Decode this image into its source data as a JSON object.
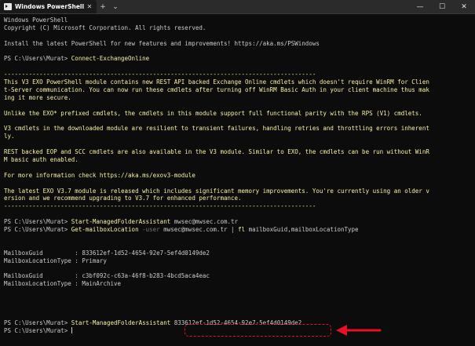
{
  "window": {
    "tab_title": "Windows PowerShell",
    "tab_close": "✕",
    "new_tab": "+",
    "dropdown": "⌄",
    "minimize": "—",
    "maximize": "☐",
    "close": "✕"
  },
  "terminal": {
    "lines": [
      {
        "parts": [
          {
            "t": "Windows PowerShell",
            "c": ""
          }
        ]
      },
      {
        "parts": [
          {
            "t": "Copyright (C) Microsoft Corporation. All rights reserved.",
            "c": ""
          }
        ]
      },
      {
        "parts": [
          {
            "t": "",
            "c": ""
          }
        ]
      },
      {
        "parts": [
          {
            "t": "Install the latest PowerShell for new features and improvements! https://aka.ms/PSWindows",
            "c": ""
          }
        ]
      },
      {
        "parts": [
          {
            "t": "",
            "c": ""
          }
        ]
      },
      {
        "parts": [
          {
            "t": "PS C:\\Users\\Murat> ",
            "c": ""
          },
          {
            "t": "Connect-ExchangeOnline",
            "c": "y"
          }
        ]
      },
      {
        "parts": [
          {
            "t": "",
            "c": ""
          }
        ]
      },
      {
        "parts": [
          {
            "t": "----------------------------------------------------------------------------------------",
            "c": "sep"
          }
        ]
      },
      {
        "parts": [
          {
            "t": "This V3 EXO PowerShell module contains new REST API backed Exchange Online cmdlets which doesn't require WinRM for Clien",
            "c": "y"
          }
        ]
      },
      {
        "parts": [
          {
            "t": "t-Server communication. You can now run these cmdlets after turning off WinRM Basic Auth in your client machine thus mak",
            "c": "y"
          }
        ]
      },
      {
        "parts": [
          {
            "t": "ing it more secure.",
            "c": "y"
          }
        ]
      },
      {
        "parts": [
          {
            "t": "",
            "c": ""
          }
        ]
      },
      {
        "parts": [
          {
            "t": "Unlike the EXO* prefixed cmdlets, the cmdlets in this module support full functional parity with the RPS (V1) cmdlets.",
            "c": "y"
          }
        ]
      },
      {
        "parts": [
          {
            "t": "",
            "c": ""
          }
        ]
      },
      {
        "parts": [
          {
            "t": "V3 cmdlets in the downloaded module are resilient to transient failures, handling retries and throttling errors inherent",
            "c": "y"
          }
        ]
      },
      {
        "parts": [
          {
            "t": "ly.",
            "c": "y"
          }
        ]
      },
      {
        "parts": [
          {
            "t": "",
            "c": ""
          }
        ]
      },
      {
        "parts": [
          {
            "t": "REST backed EOP and SCC cmdlets are also available in the V3 module. Similar to EXO, the cmdlets can be run without WinR",
            "c": "y"
          }
        ]
      },
      {
        "parts": [
          {
            "t": "M basic auth enabled.",
            "c": "y"
          }
        ]
      },
      {
        "parts": [
          {
            "t": "",
            "c": ""
          }
        ]
      },
      {
        "parts": [
          {
            "t": "For more information check https://aka.ms/exov3-module",
            "c": "y"
          }
        ]
      },
      {
        "parts": [
          {
            "t": "",
            "c": ""
          }
        ]
      },
      {
        "parts": [
          {
            "t": "The latest EXO V3.7 module is released which includes significant memory improvements. You're currently using an older v",
            "c": "y"
          }
        ]
      },
      {
        "parts": [
          {
            "t": "ersion and we recommend upgrading to V3.7 for enhanced performance.",
            "c": "y"
          }
        ]
      },
      {
        "parts": [
          {
            "t": "----------------------------------------------------------------------------------------",
            "c": "sep"
          }
        ]
      },
      {
        "parts": [
          {
            "t": "",
            "c": ""
          }
        ]
      },
      {
        "parts": [
          {
            "t": "PS C:\\Users\\Murat> ",
            "c": ""
          },
          {
            "t": "Start-ManagedFolderAssistant",
            "c": "y"
          },
          {
            "t": " mwsec@mwsec.com.tr",
            "c": ""
          }
        ]
      },
      {
        "parts": [
          {
            "t": "PS C:\\Users\\Murat> ",
            "c": ""
          },
          {
            "t": "Get-mailboxLocation",
            "c": "y"
          },
          {
            "t": " -user",
            "c": "gray"
          },
          {
            "t": " mwsec@mwsec.com.tr | ",
            "c": ""
          },
          {
            "t": "fl",
            "c": "y"
          },
          {
            "t": " mailboxGuid,mailboxLocationType",
            "c": ""
          }
        ]
      },
      {
        "parts": [
          {
            "t": "",
            "c": ""
          }
        ]
      },
      {
        "parts": [
          {
            "t": "",
            "c": ""
          }
        ]
      },
      {
        "parts": [
          {
            "t": "MailboxGuid         : 833612ef-1d52-4654-92e7-5ef4d0149de2",
            "c": ""
          }
        ]
      },
      {
        "parts": [
          {
            "t": "MailboxLocationType : Primary",
            "c": ""
          }
        ]
      },
      {
        "parts": [
          {
            "t": "",
            "c": ""
          }
        ]
      },
      {
        "parts": [
          {
            "t": "MailboxGuid         : c3bf092c-c63a-46f8-b283-4bcd5aca4eac",
            "c": ""
          }
        ]
      },
      {
        "parts": [
          {
            "t": "MailboxLocationType : MainArchive",
            "c": ""
          }
        ]
      },
      {
        "parts": [
          {
            "t": "",
            "c": ""
          }
        ]
      },
      {
        "parts": [
          {
            "t": "",
            "c": ""
          }
        ]
      },
      {
        "parts": [
          {
            "t": "",
            "c": ""
          }
        ]
      },
      {
        "parts": [
          {
            "t": "",
            "c": ""
          }
        ]
      },
      {
        "parts": [
          {
            "t": "PS C:\\Users\\Murat> ",
            "c": ""
          },
          {
            "t": "Start-ManagedFolderAssistant",
            "c": "y"
          },
          {
            "t": " 833612ef-1d52-4654-92e7-5ef4d0149de2",
            "c": ""
          }
        ]
      },
      {
        "parts": [
          {
            "t": "PS C:\\Users\\Murat> ",
            "c": ""
          }
        ],
        "cursor": true
      }
    ]
  },
  "annotation": {
    "highlight_color": "#e81123"
  },
  "colors": {
    "background": "#0c0c0c",
    "text": "#cccccc",
    "yellow": "#f9f1a5",
    "titlebar": "#2b2b2b"
  }
}
